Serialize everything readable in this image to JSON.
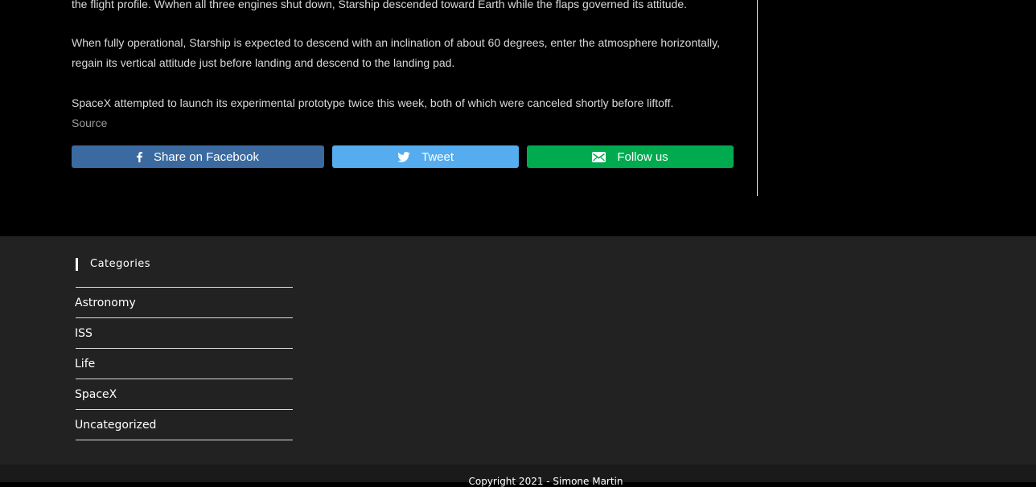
{
  "article": {
    "paragraph_1": "the flight profile. Wwhen all three engines shut down, Starship descended toward Earth while the flaps governed its attitude.",
    "paragraph_2": "When fully operational, Starship is expected to descend with an inclination of about 60 degrees, enter the atmosphere horizontally, regain its vertical attitude just before landing and descend to the landing pad.",
    "paragraph_3": "SpaceX attempted to launch its experimental prototype twice this week, both of which were canceled shortly before liftoff.",
    "source_link": "Source"
  },
  "share": {
    "facebook": {
      "label": "Share on Facebook",
      "icon": "facebook-icon",
      "color": "#3b6aa0"
    },
    "twitter": {
      "label": "Tweet",
      "icon": "twitter-bird-icon",
      "color": "#55acee"
    },
    "follow": {
      "label": "Follow us",
      "icon": "envelope-icon",
      "color": "#00aa4f"
    }
  },
  "footer": {
    "widget_title": "Categories",
    "categories": [
      {
        "label": "Astronomy"
      },
      {
        "label": "ISS"
      },
      {
        "label": "Life"
      },
      {
        "label": "SpaceX"
      },
      {
        "label": "Uncategorized"
      }
    ],
    "copyright": "Copyright 2021 - Simone Martin"
  }
}
